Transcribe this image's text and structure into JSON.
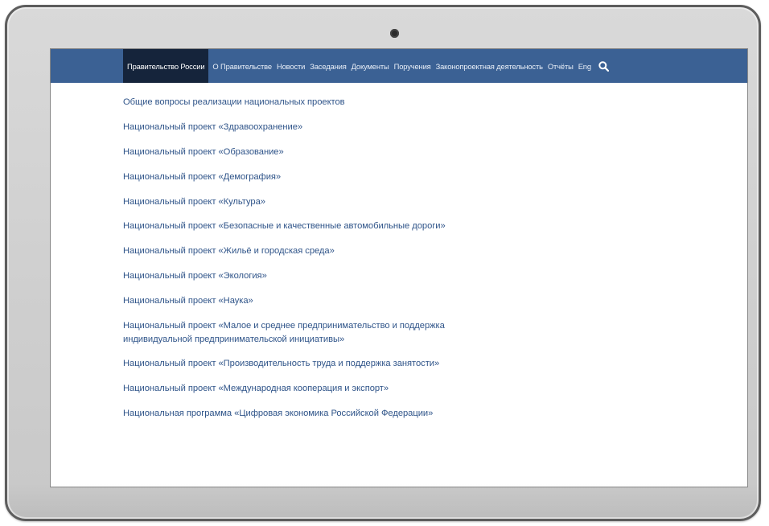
{
  "nav": {
    "items": [
      {
        "label": "Правительство России",
        "active": true
      },
      {
        "label": "О Правительстве"
      },
      {
        "label": "Новости"
      },
      {
        "label": "Заседания"
      },
      {
        "label": "Документы"
      },
      {
        "label": "Поручения"
      },
      {
        "label": "Законопроектная деятельность"
      },
      {
        "label": "Отчёты"
      },
      {
        "label": "Eng"
      }
    ],
    "search_icon": "search-icon",
    "bar_color": "#3b6194",
    "active_color": "#15243b"
  },
  "links": [
    "Общие вопросы реализации национальных проектов",
    "Национальный проект «Здравоохранение»",
    "Национальный проект «Образование»",
    "Национальный проект «Демография»",
    "Национальный проект «Культура»",
    "Национальный проект «Безопасные и качественные автомобильные дороги»",
    "Национальный проект «Жильё и городская среда»",
    "Национальный проект «Экология»",
    "Национальный проект «Наука»",
    "Национальный проект «Малое и среднее предпринимательство и поддержка индивидуальной предпринимательской инициативы»",
    "Национальный проект «Производительность труда и поддержка занятости»",
    "Национальный проект «Международная кооперация и экспорт»",
    "Национальная программа «Цифровая экономика Российской Федерации»"
  ],
  "link_color": "#2f5489"
}
